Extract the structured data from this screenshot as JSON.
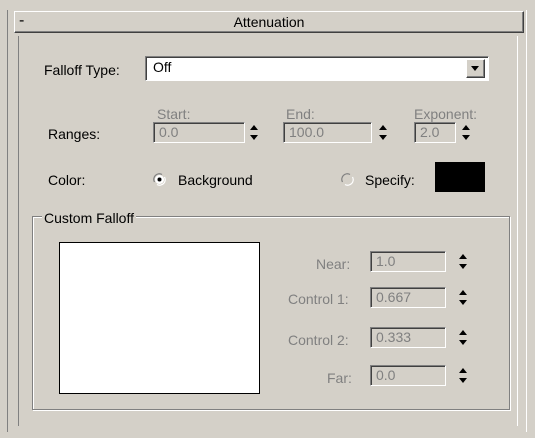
{
  "rollout": {
    "title": "Attenuation",
    "toggle": "-"
  },
  "falloff_type": {
    "label": "Falloff Type:",
    "value": "Off"
  },
  "ranges": {
    "label": "Ranges:",
    "start": {
      "label": "Start:",
      "value": "0.0"
    },
    "end": {
      "label": "End:",
      "value": "100.0"
    },
    "exponent": {
      "label": "Exponent:",
      "value": "2.0"
    }
  },
  "color": {
    "label": "Color:",
    "background_label": "Background",
    "specify_label": "Specify:",
    "swatch_color": "#000000",
    "selected": "Background"
  },
  "custom_falloff": {
    "title": "Custom Falloff",
    "near": {
      "label": "Near:",
      "value": "1.0"
    },
    "control1": {
      "label": "Control 1:",
      "value": "0.667"
    },
    "control2": {
      "label": "Control 2:",
      "value": "0.333"
    },
    "far": {
      "label": "Far:",
      "value": "0.0"
    }
  }
}
